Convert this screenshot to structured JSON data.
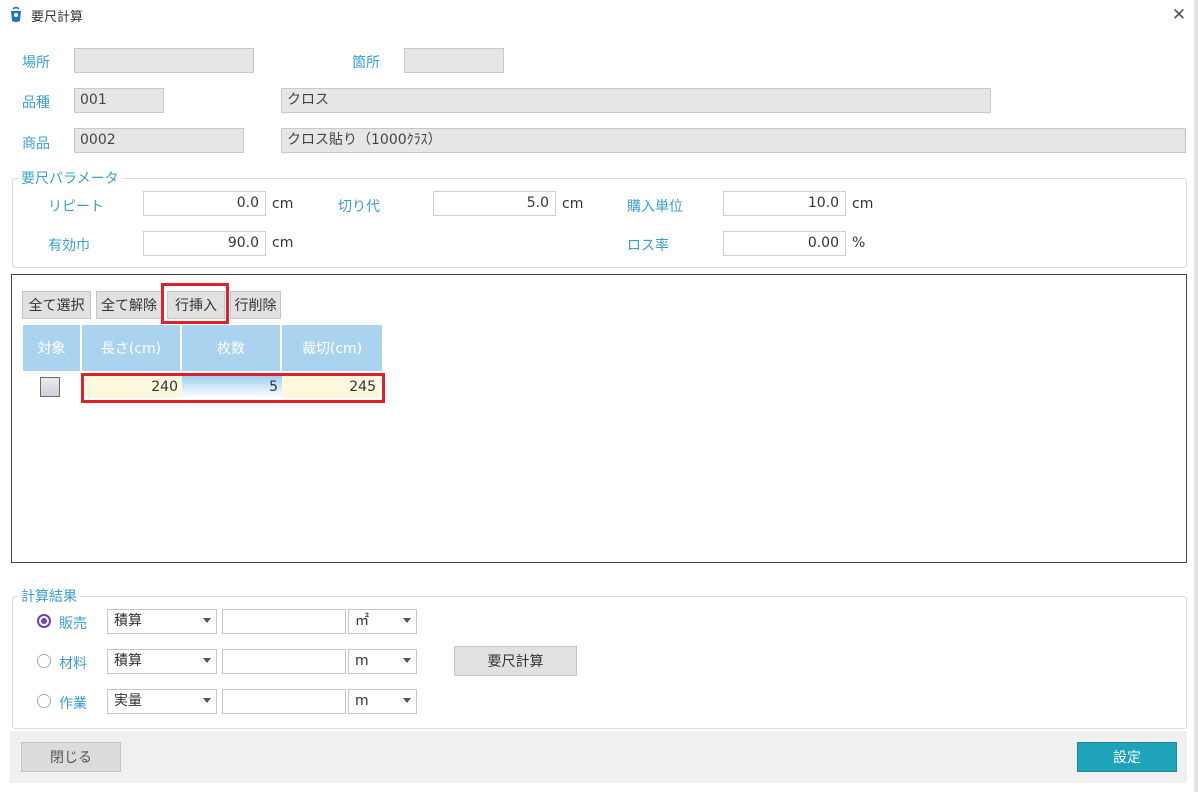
{
  "window": {
    "title": "要尺計算",
    "close_glyph": "✕"
  },
  "header": {
    "location_label": "場所",
    "location_value": "",
    "spot_label": "箇所",
    "spot_value": "",
    "variety_label": "品種",
    "variety_code": "001",
    "variety_name": "クロス",
    "product_label": "商品",
    "product_code": "0002",
    "product_name": "クロス貼り（1000ｸﾗｽ）"
  },
  "params": {
    "group_title": "要尺パラメータ",
    "repeat_label": "リピート",
    "repeat_value": "0.0",
    "repeat_unit": "cm",
    "cut_margin_label": "切り代",
    "cut_margin_value": "5.0",
    "cut_margin_unit": "cm",
    "purchase_unit_label": "購入単位",
    "purchase_unit_value": "10.0",
    "purchase_unit_unit": "cm",
    "effective_width_label": "有効巾",
    "effective_width_value": "90.0",
    "effective_width_unit": "cm",
    "loss_rate_label": "ロス率",
    "loss_rate_value": "0.00",
    "loss_rate_unit": "%"
  },
  "grid": {
    "buttons": {
      "select_all": "全て選択",
      "deselect_all": "全て解除",
      "insert_row": "行挿入",
      "delete_row": "行削除"
    },
    "columns": [
      "対象",
      "長さ(cm)",
      "枚数",
      "裁切(cm)"
    ],
    "rows": [
      {
        "checked": false,
        "length": "240",
        "count": "5",
        "cut": "245"
      }
    ]
  },
  "results": {
    "group_title": "計算結果",
    "rows": [
      {
        "label": "販売",
        "selected": true,
        "method": "積算",
        "value": "",
        "unit": "㎡"
      },
      {
        "label": "材料",
        "selected": false,
        "method": "積算",
        "value": "",
        "unit": "m"
      },
      {
        "label": "作業",
        "selected": false,
        "method": "実量",
        "value": "",
        "unit": "m"
      }
    ],
    "calc_button": "要尺計算"
  },
  "footer": {
    "close_button": "閉じる",
    "set_button": "設定"
  },
  "colors": {
    "label": "#3aa0d0",
    "header": "#a9d3ef",
    "highlight": "#e0202a",
    "set_button": "#1ea3b8",
    "radio": "#6b3fc6"
  }
}
